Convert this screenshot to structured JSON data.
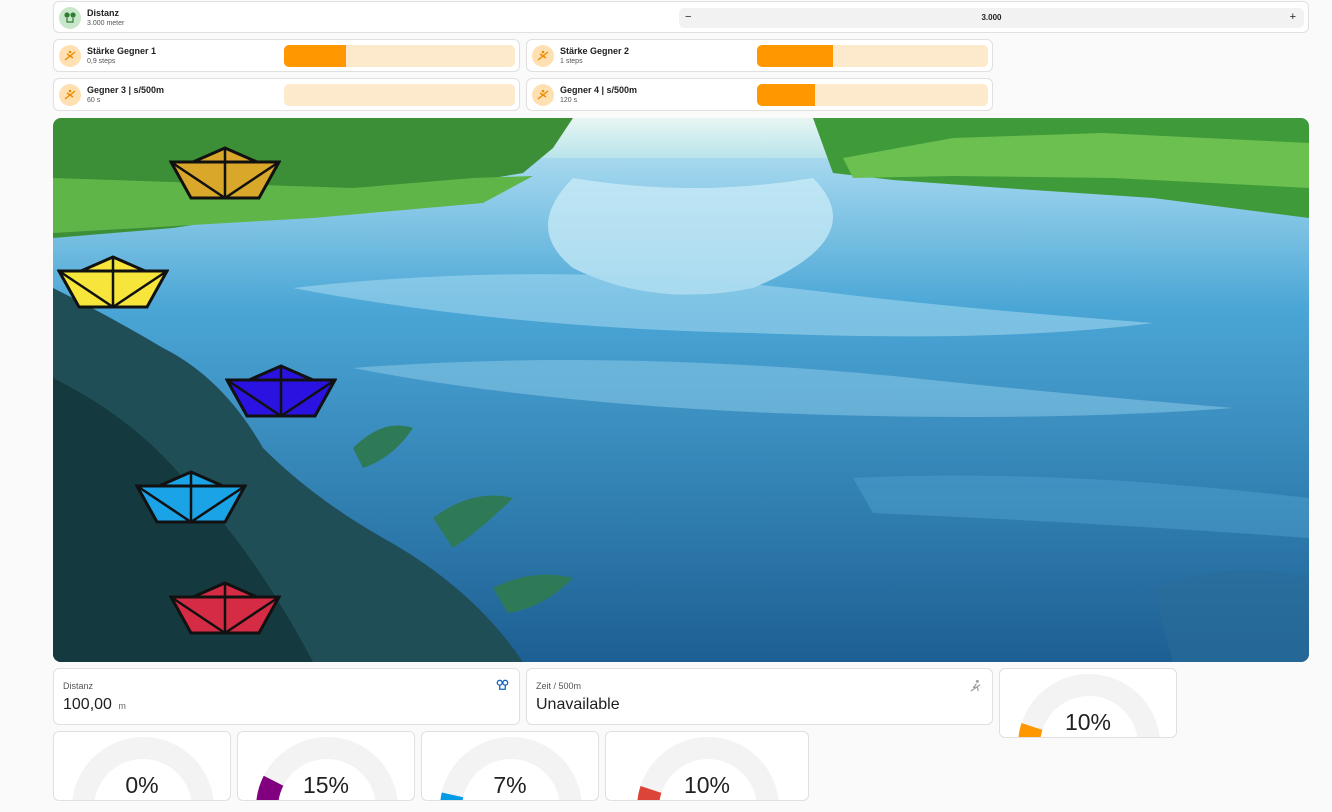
{
  "distanz_entity": {
    "name": "Distanz",
    "value": "3.000 meter",
    "number_value": "3.000",
    "minus": "−",
    "plus": "+",
    "icon": "map-marker-distance-icon"
  },
  "sliders": [
    {
      "name": "Stärke Gegner 1",
      "value": "0,9 steps",
      "fill_fraction": 0.27,
      "icon": "boat-rowing-icon"
    },
    {
      "name": "Stärke Gegner 2",
      "value": "1 steps",
      "fill_fraction": 0.33,
      "icon": "boat-rowing-icon"
    },
    {
      "name": "Gegner 3 | s/500m",
      "value": "60 s",
      "fill_fraction": 0.0,
      "icon": "boat-rowing-icon"
    },
    {
      "name": "Gegner 4 | s/500m",
      "value": "120 s",
      "fill_fraction": 0.25,
      "icon": "boat-rowing-icon"
    }
  ],
  "colors": {
    "accent": "#ff9800",
    "accent_light": "#fde9cc",
    "boat_gold": "#d9a72a",
    "boat_yellow": "#f7e53b",
    "boat_blue": "#2a13e0",
    "boat_cyan": "#1aa3e6",
    "boat_red": "#d62b45",
    "icon_blue": "#1565c0"
  },
  "tiles": [
    {
      "label": "Distanz",
      "value": "100,00",
      "unit": "m",
      "icon": "map-marker-distance-icon"
    },
    {
      "label": "Zeit / 500m",
      "value": "Unavailable",
      "unit": "",
      "icon": "rowing-icon"
    }
  ],
  "gauges": [
    {
      "value": "10%",
      "percent": 10,
      "color": "#ff9800"
    },
    {
      "value": "0%",
      "percent": 0,
      "color": "#9e9e9e"
    },
    {
      "value": "15%",
      "percent": 15,
      "color": "#800080"
    },
    {
      "value": "7%",
      "percent": 7,
      "color": "#039be5"
    },
    {
      "value": "10%",
      "percent": 10,
      "color": "#db4437"
    }
  ]
}
